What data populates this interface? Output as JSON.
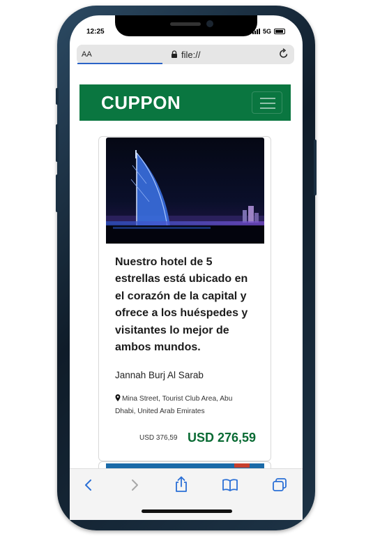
{
  "status_bar": {
    "time": "12:25",
    "network": "5G"
  },
  "browser": {
    "text_size_label": "AA",
    "url": "file://"
  },
  "navbar": {
    "brand": "CUPPON"
  },
  "deal": {
    "description": "Nuestro hotel de 5 estrellas está ubicado en el corazón de la capital y ofrece a los huéspedes y visitantes lo mejor de ambos mundos.",
    "hotel_name": "Jannah Burj Al Sarab",
    "address": "Mina Street, Tourist Club Area, Abu Dhabi, United Arab Emirates",
    "original_price": "USD 376,59",
    "discount_price": "USD 276,59"
  },
  "colors": {
    "brand_green": "#0a7640",
    "price_green": "#0a6b34"
  },
  "toolbar": {
    "icons": [
      "back-icon",
      "forward-icon",
      "share-icon",
      "bookmarks-icon",
      "tabs-icon"
    ]
  }
}
